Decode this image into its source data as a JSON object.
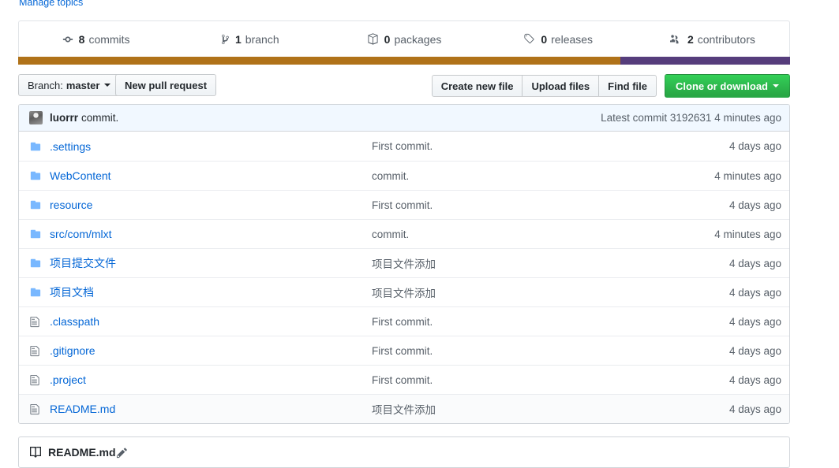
{
  "topics": {
    "manage_label": "Manage topics"
  },
  "stats": [
    {
      "icon": "git-commit-icon",
      "count": "8",
      "label": "commits",
      "name": "commits"
    },
    {
      "icon": "branch-icon",
      "count": "1",
      "label": "branch",
      "name": "branches"
    },
    {
      "icon": "package-icon",
      "count": "0",
      "label": "packages",
      "name": "packages"
    },
    {
      "icon": "tag-icon",
      "count": "0",
      "label": "releases",
      "name": "releases"
    },
    {
      "icon": "people-icon",
      "count": "2",
      "label": "contributors",
      "name": "contributors"
    }
  ],
  "languages": [
    {
      "color": "#b07219",
      "percent": 78
    },
    {
      "color": "#563d7c",
      "percent": 22
    }
  ],
  "toolbar": {
    "branch_prefix": "Branch:",
    "branch_name": "master",
    "new_pull_request": "New pull request",
    "create_new_file": "Create new file",
    "upload_files": "Upload files",
    "find_file": "Find file",
    "clone_or_download": "Clone or download"
  },
  "latest_commit": {
    "author": "luorrr",
    "message": "commit.",
    "prefix": "Latest commit",
    "sha": "3192631",
    "age": "4 minutes ago"
  },
  "files": {
    "rows": [
      {
        "type": "folder",
        "name": ".settings",
        "message": "First commit.",
        "age": "4 days ago"
      },
      {
        "type": "folder",
        "name": "WebContent",
        "message": "commit.",
        "age": "4 minutes ago"
      },
      {
        "type": "folder",
        "name": "resource",
        "message": "First commit.",
        "age": "4 days ago"
      },
      {
        "type": "folder",
        "name": "src/com/mlxt",
        "message": "commit.",
        "age": "4 minutes ago"
      },
      {
        "type": "folder",
        "name": "项目提交文件",
        "message": "项目文件添加",
        "age": "4 days ago"
      },
      {
        "type": "folder",
        "name": "项目文档",
        "message": "项目文件添加",
        "age": "4 days ago"
      },
      {
        "type": "file",
        "name": ".classpath",
        "message": "First commit.",
        "age": "4 days ago"
      },
      {
        "type": "file",
        "name": ".gitignore",
        "message": "First commit.",
        "age": "4 days ago"
      },
      {
        "type": "file",
        "name": ".project",
        "message": "First commit.",
        "age": "4 days ago"
      },
      {
        "type": "file",
        "name": "README.md",
        "message": "项目文件添加",
        "age": "4 days ago"
      }
    ]
  },
  "readme": {
    "title": "README.md",
    "edit_icon": "pencil-icon"
  }
}
